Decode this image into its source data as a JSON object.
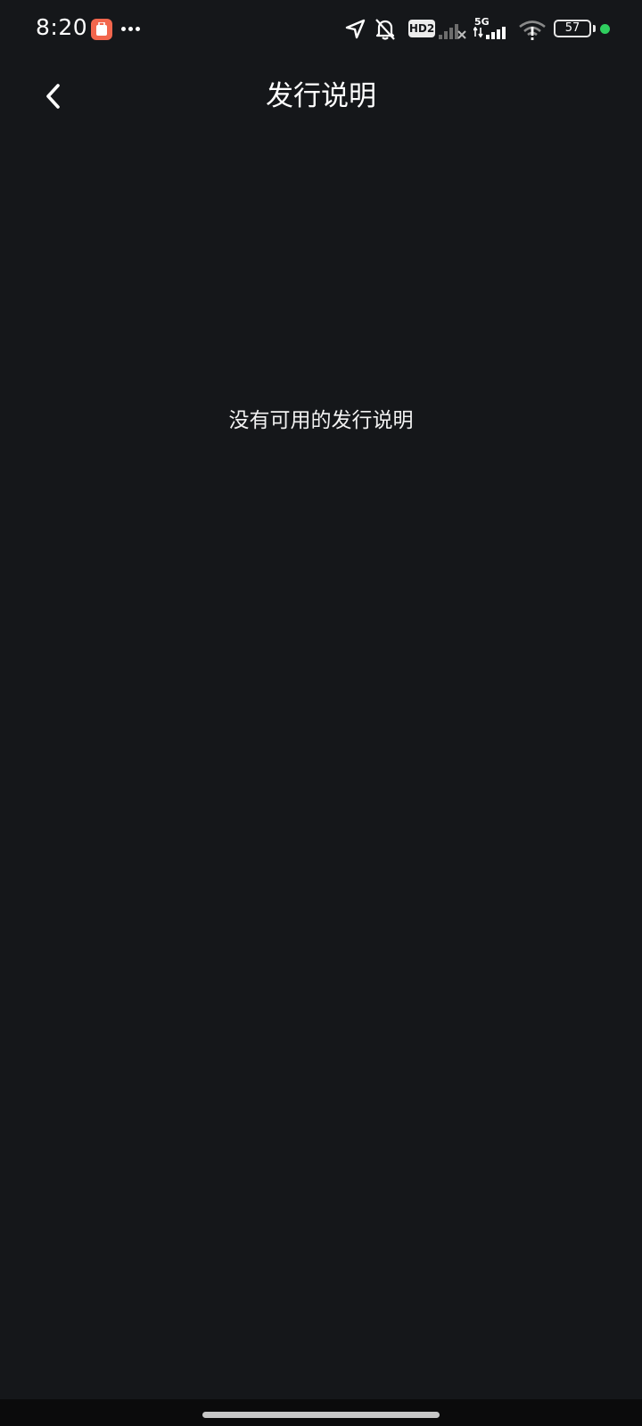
{
  "status_bar": {
    "time": "8:20",
    "hd_badge": "HD2",
    "network_label": "5G",
    "battery_percent": "57",
    "icons": [
      "app-notification-icon",
      "more-dots-icon",
      "location-arrow-icon",
      "bell-muted-icon",
      "signal-bars-icon",
      "wifi-icon",
      "battery-icon"
    ],
    "accent_dot_color": "#2fcf5f",
    "app_icon_color": "#f2664d"
  },
  "header": {
    "title": "发行说明",
    "back_icon": "chevron-left-icon"
  },
  "main": {
    "empty_message": "没有可用的发行说明"
  },
  "colors": {
    "background": "#15171a",
    "text": "#ffffff"
  }
}
